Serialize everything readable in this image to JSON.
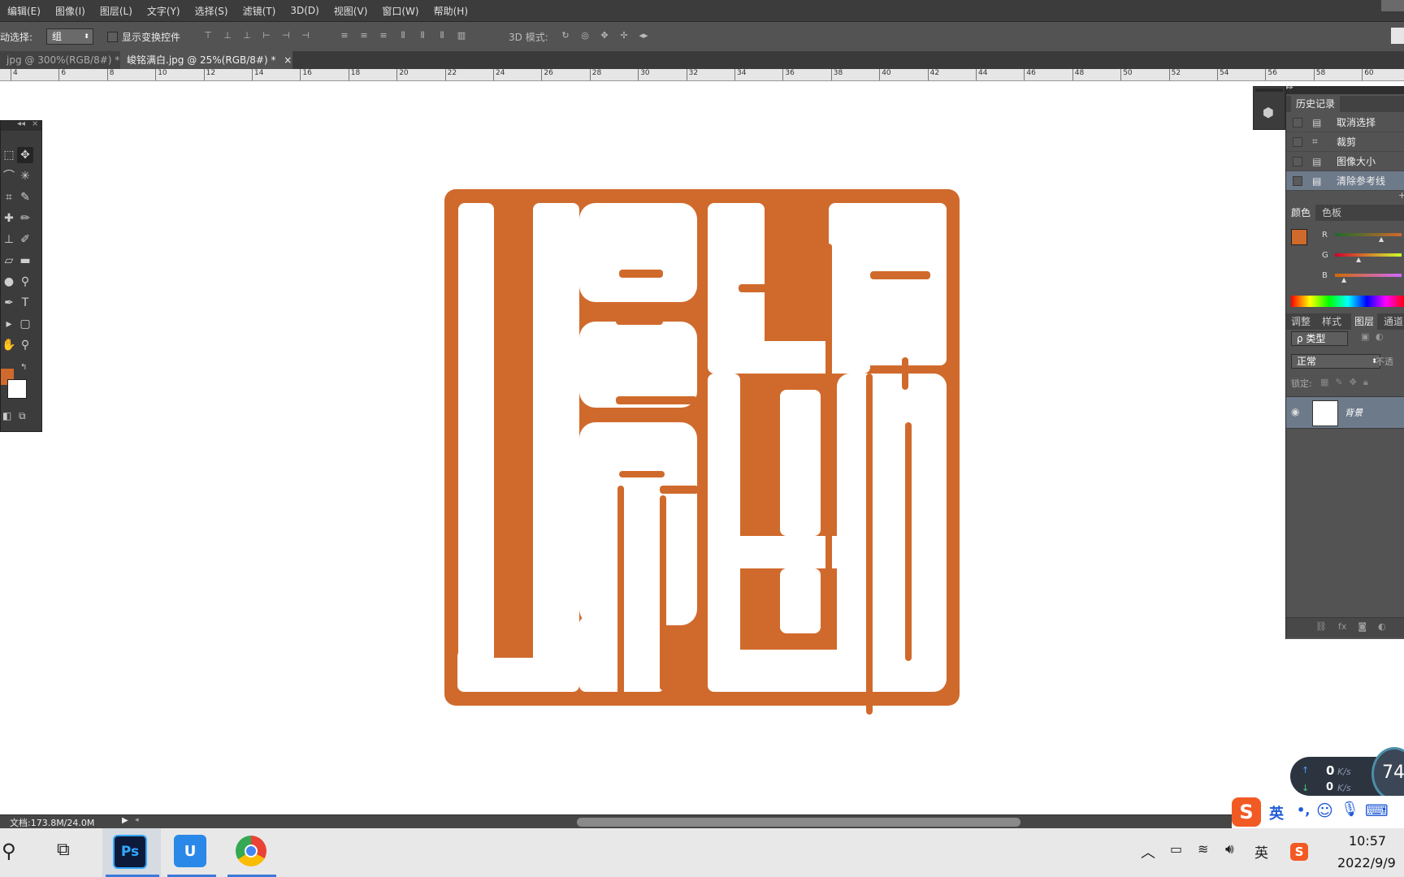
{
  "menu": [
    "编辑(E)",
    "图像(I)",
    "图层(L)",
    "文字(Y)",
    "选择(S)",
    "滤镜(T)",
    "3D(D)",
    "视图(V)",
    "窗口(W)",
    "帮助(H)"
  ],
  "options": {
    "auto_select_label": "动选择:",
    "auto_select_value": "组",
    "show_transform_label": "显示变换控件",
    "mode_3d_label": "3D 模式:"
  },
  "tabs": [
    {
      "label": "jpg @ 300%(RGB/8#) *",
      "close": "×"
    },
    {
      "label": "峻铭满白.jpg @ 25%(RGB/8#) *",
      "close": "×"
    }
  ],
  "ruler_labels": [
    "4",
    "6",
    "8",
    "10",
    "12",
    "14",
    "16",
    "18",
    "20",
    "22",
    "24",
    "26",
    "28",
    "30",
    "32",
    "34",
    "36",
    "38",
    "40",
    "42",
    "44",
    "46",
    "48",
    "50",
    "52",
    "54",
    "56",
    "58",
    "60"
  ],
  "colors": {
    "seal": "#d06a2c",
    "foreground": "#d06a2c",
    "background": "#ffffff",
    "chrome_dark": "#3c3c3c",
    "chrome_mid": "#535353"
  },
  "history": {
    "title": "历史记录",
    "items": [
      {
        "label": "取消选择",
        "icon": "document-icon"
      },
      {
        "label": "裁剪",
        "icon": "crop-icon"
      },
      {
        "label": "图像大小",
        "icon": "document-icon"
      },
      {
        "label": "清除参考线",
        "icon": "document-icon",
        "selected": true
      }
    ]
  },
  "color_panel": {
    "tabs": [
      "颜色",
      "色板"
    ],
    "channels": [
      "R",
      "G",
      "B"
    ]
  },
  "layers_panel": {
    "tabs": [
      "调整",
      "样式",
      "图层",
      "通道"
    ],
    "filter": "ρ 类型",
    "blend_mode": "正常",
    "opacity_label": "不透",
    "lock_label": "锁定:",
    "layer_name": "背景"
  },
  "status": {
    "doc_info": "文档:173.8M/24.0M"
  },
  "net_widget": {
    "up": "0",
    "up_unit": "K/s",
    "down": "0",
    "down_unit": "K/s",
    "percent": "74"
  },
  "ime": {
    "lang": "英",
    "punct": "•,"
  },
  "tray": {
    "lang": "英",
    "time": "10:57",
    "date": "2022/9/9"
  },
  "taskbar_apps": [
    {
      "name": "photoshop",
      "label": "Ps"
    },
    {
      "name": "baidu-netdisk",
      "label": "U"
    },
    {
      "name": "chrome",
      "label": ""
    }
  ]
}
